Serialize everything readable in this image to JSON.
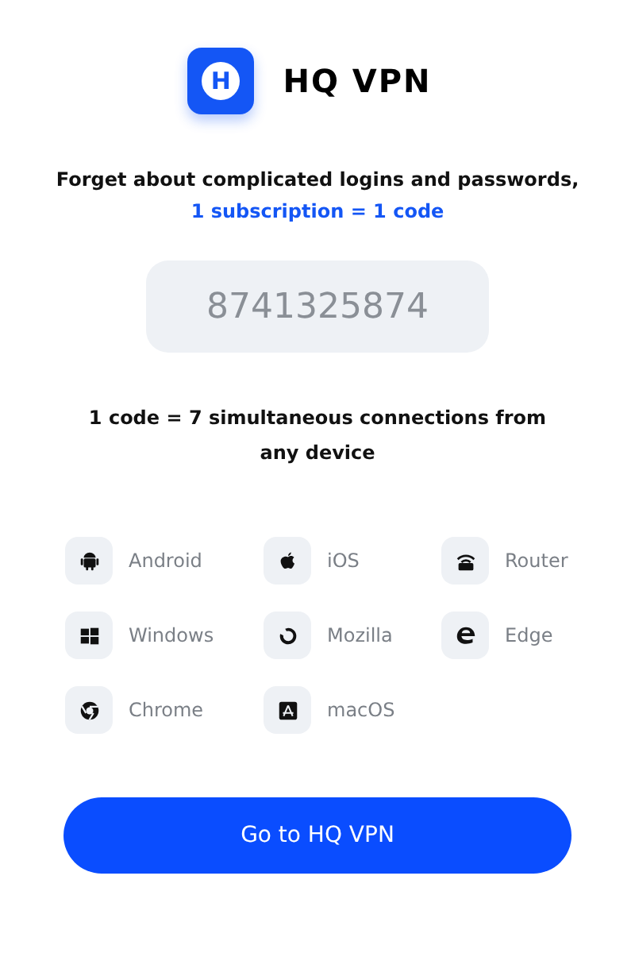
{
  "brand": {
    "name": "HQ VPN",
    "logo_letter": "H"
  },
  "tagline": "Forget about complicated logins and passwords,",
  "highlight": "1 subscription = 1 code",
  "code": "8741325874",
  "connections": "1 code = 7 simultaneous connections from any device",
  "platforms": [
    {
      "label": "Android",
      "kind": "android"
    },
    {
      "label": "iOS",
      "kind": "apple"
    },
    {
      "label": "Router",
      "kind": "router"
    },
    {
      "label": "Windows",
      "kind": "windows"
    },
    {
      "label": "Mozilla",
      "kind": "mozilla"
    },
    {
      "label": "Edge",
      "kind": "edge"
    },
    {
      "label": "Chrome",
      "kind": "chrome"
    },
    {
      "label": "macOS",
      "kind": "appstore"
    }
  ],
  "button": "Go to HQ VPN"
}
